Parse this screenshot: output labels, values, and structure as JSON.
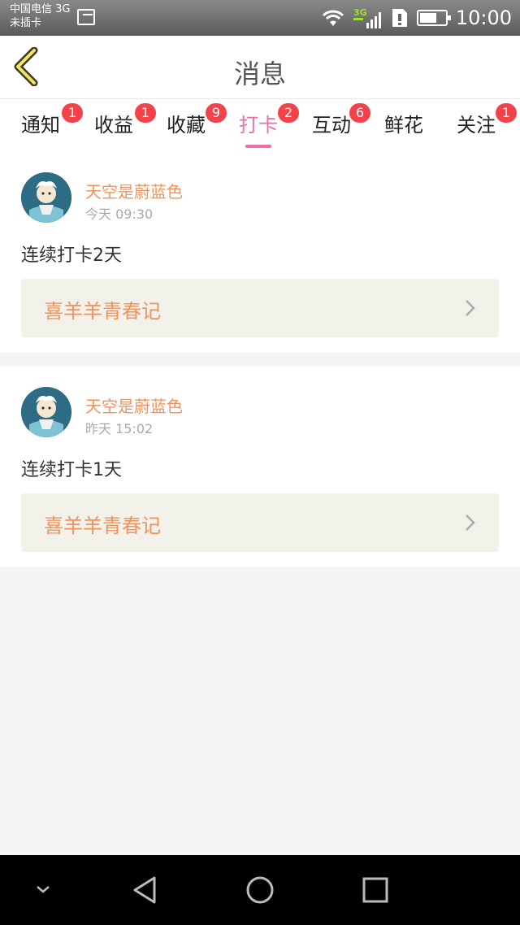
{
  "status": {
    "carrier_line1": "中国电信 3G",
    "carrier_line2": "未插卡",
    "network": "3G",
    "time": "10:00"
  },
  "header": {
    "title": "消息"
  },
  "tabs": [
    {
      "label": "通知",
      "badge": "1"
    },
    {
      "label": "收益",
      "badge": "1"
    },
    {
      "label": "收藏",
      "badge": "9"
    },
    {
      "label": "打卡",
      "badge": "2",
      "active": true
    },
    {
      "label": "互动",
      "badge": "6"
    },
    {
      "label": "鲜花",
      "badge": ""
    },
    {
      "label": "关注",
      "badge": "1"
    }
  ],
  "messages": [
    {
      "user": "天空是蔚蓝色",
      "time": "今天 09:30",
      "text": "连续打卡2天",
      "link": "喜羊羊青春记"
    },
    {
      "user": "天空是蔚蓝色",
      "time": "昨天 15:02",
      "text": "连续打卡1天",
      "link": "喜羊羊青春记"
    }
  ],
  "colors": {
    "accent": "#e96fa4",
    "name": "#f0935a",
    "badge": "#f2434b"
  }
}
